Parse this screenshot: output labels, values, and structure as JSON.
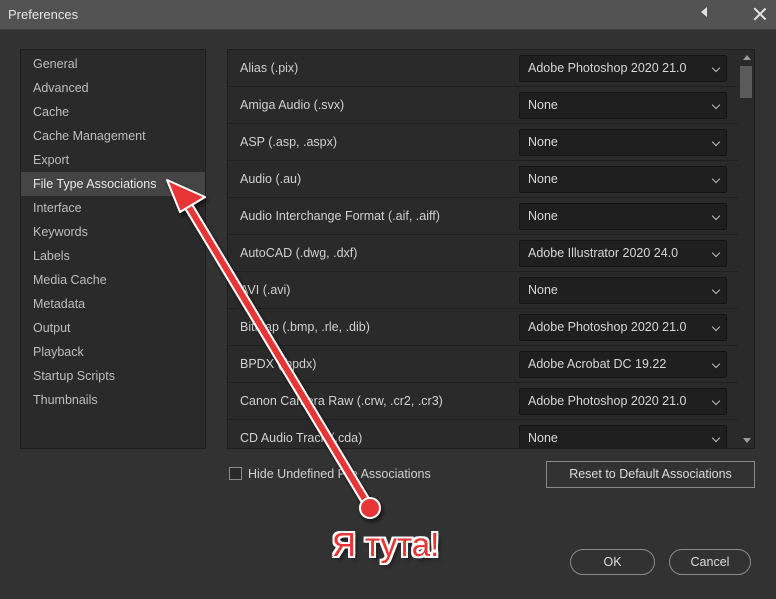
{
  "window": {
    "title": "Preferences"
  },
  "sidebar": {
    "items": [
      {
        "label": "General"
      },
      {
        "label": "Advanced"
      },
      {
        "label": "Cache"
      },
      {
        "label": "Cache Management"
      },
      {
        "label": "Export"
      },
      {
        "label": "File Type Associations",
        "selected": true
      },
      {
        "label": "Interface"
      },
      {
        "label": "Keywords"
      },
      {
        "label": "Labels"
      },
      {
        "label": "Media Cache"
      },
      {
        "label": "Metadata"
      },
      {
        "label": "Output"
      },
      {
        "label": "Playback"
      },
      {
        "label": "Startup Scripts"
      },
      {
        "label": "Thumbnails"
      }
    ]
  },
  "associations": [
    {
      "format": "Alias (.pix)",
      "app": "Adobe Photoshop 2020 21.0"
    },
    {
      "format": "Amiga Audio (.svx)",
      "app": "None"
    },
    {
      "format": "ASP (.asp, .aspx)",
      "app": "None"
    },
    {
      "format": "Audio (.au)",
      "app": "None"
    },
    {
      "format": "Audio Interchange Format (.aif, .aiff)",
      "app": "None"
    },
    {
      "format": "AutoCAD (.dwg, .dxf)",
      "app": "Adobe Illustrator 2020 24.0"
    },
    {
      "format": "AVI (.avi)",
      "app": "None"
    },
    {
      "format": "Bitmap (.bmp, .rle, .dib)",
      "app": "Adobe Photoshop 2020 21.0"
    },
    {
      "format": "BPDX (.bpdx)",
      "app": "Adobe Acrobat DC 19.22"
    },
    {
      "format": "Canon Camera Raw (.crw, .cr2, .cr3)",
      "app": "Adobe Photoshop 2020 21.0"
    },
    {
      "format": "CD Audio Track (.cda)",
      "app": "None"
    }
  ],
  "options": {
    "hide_undefined_label": "Hide Undefined File Associations"
  },
  "buttons": {
    "reset": "Reset to Default Associations",
    "ok": "OK",
    "cancel": "Cancel"
  },
  "annotation": {
    "text": "Я тута!",
    "color": "#e83535"
  }
}
